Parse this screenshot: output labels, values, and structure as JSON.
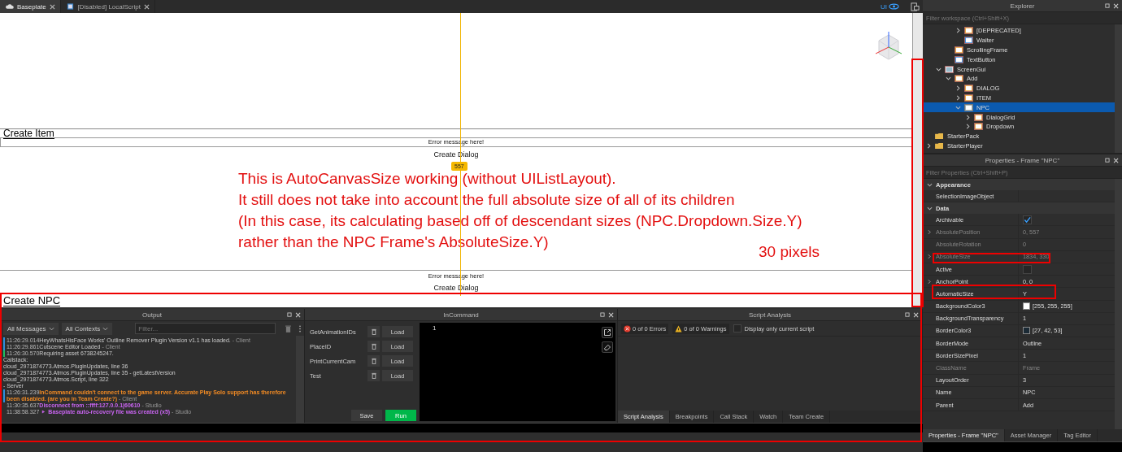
{
  "tabs": [
    {
      "label": "Baseplate",
      "selected": true
    },
    {
      "label": "[Disabled] LocalScript",
      "selected": false
    }
  ],
  "toolbar_right": {
    "label": "UI"
  },
  "viewport": {
    "item_label": "Create Item",
    "error_text_1": "Error message here!",
    "dialog_label_1": "Create Dialog",
    "badge": "557",
    "annotation_lines": [
      "This is AutoCanvasSize working (without UIListLayout).",
      "It still does not take into account the full absolute size of all of its children",
      "(In this case, its calculating based off of descendant sizes (NPC.Dropdown.Size.Y)",
      "rather than the NPC Frame's AbsoluteSize.Y)"
    ],
    "annotation_note": "30 pixels",
    "error_text_2": "Error message here!",
    "dialog_label_2": "Create Dialog",
    "npc_label": "Create NPC"
  },
  "output": {
    "title": "Output",
    "message_filter": "All Messages",
    "context_filter": "All Contexts",
    "filter_placeholder": "Filter...",
    "lines": [
      {
        "kind": "info",
        "color": "#2f8fdc",
        "time": "11:26:29.014",
        "message": "HeyWhatsHisFace Works' Outline Remover Plugin Version v1.1 has loaded.",
        "source": " - Client"
      },
      {
        "kind": "info",
        "color": "#2f8fdc",
        "time": "11:26:29.861",
        "message": "Cutscene Editor Loaded",
        "source": " - Client"
      },
      {
        "kind": "info",
        "color": "#1fbf5f",
        "time": "11:26:30.570",
        "message": "Requiring asset 6738245247."
      },
      {
        "kind": "plain",
        "message": "Callstack:"
      },
      {
        "kind": "plain",
        "message": "cloud_2971874773.Atmos.PluginUpdates, line 36"
      },
      {
        "kind": "plain",
        "message": "cloud_2971874773.Atmos.PluginUpdates, line 35 - getLatestVersion"
      },
      {
        "kind": "plain",
        "message": "cloud_2971874773.Atmos.Script, line 322"
      },
      {
        "kind": "plain",
        "message": "  - Server"
      },
      {
        "kind": "warning",
        "color": "#2f8fdc",
        "time": "11:26:31.239",
        "message": "InCommand couldn't connect to the game server. Accurate Play Solo support has therefore been disabled. (are you in Team Create?)",
        "source": " - Client"
      },
      {
        "kind": "studio",
        "time": "11:30:35.637",
        "message": "Disconnect from ::ffff:127.0.0.1|60610",
        "source": " - Studio"
      },
      {
        "kind": "studio_group",
        "time": "11:38:58.327",
        "message": "Baseplate auto-recovery file was created (x5)",
        "source": " - Studio"
      }
    ]
  },
  "incommand": {
    "title": "InCommand",
    "scripts": [
      {
        "name": "GetAnimationIDs",
        "action": "Load"
      },
      {
        "name": "PlaceID",
        "action": "Load"
      },
      {
        "name": "PrintCurrentCam",
        "action": "Load"
      },
      {
        "name": "Test",
        "action": "Load"
      }
    ],
    "line_number": "1",
    "save": "Save",
    "run": "Run"
  },
  "script_analysis": {
    "title": "Script Analysis",
    "errors": "0 of 0 Errors",
    "warnings": "0 of 0 Warnings",
    "only_current": {
      "label": "Display only current script",
      "checked": false
    },
    "tabs": [
      {
        "label": "Script Analysis",
        "selected": true
      },
      {
        "label": "Breakpoints",
        "selected": false
      },
      {
        "label": "Call Stack",
        "selected": false
      },
      {
        "label": "Watch",
        "selected": false
      },
      {
        "label": "Team Create",
        "selected": false
      }
    ]
  },
  "explorer": {
    "title": "Explorer",
    "filter_placeholder": "Filter workspace (Ctrl+Shift+X)",
    "tree": [
      {
        "children": [
          {
            "children": [
              {
                "children": [
                  {
                    "label": "[DEPRECATED]",
                    "kind": "frame",
                    "expanded": false,
                    "selected": false
                  },
                  {
                    "label": "Waiter",
                    "kind": "label",
                    "selected": false
                  }
                ]
              },
              {
                "label": "ScrollingFrame",
                "kind": "frame",
                "selected": false
              },
              {
                "label": "TextButton",
                "kind": "button",
                "selected": false
              }
            ]
          },
          {
            "label": "ScreenGui",
            "kind": "gui",
            "expanded": true,
            "selected": false,
            "children": [
              {
                "label": "Add",
                "kind": "frame",
                "expanded": true,
                "selected": false,
                "children": [
                  {
                    "label": "DIALOG",
                    "kind": "frame",
                    "expanded": false,
                    "selected": false
                  },
                  {
                    "label": "ITEM",
                    "kind": "frame",
                    "expanded": false,
                    "selected": false
                  },
                  {
                    "label": "NPC",
                    "kind": "frame",
                    "expanded": true,
                    "selected": true,
                    "children": [
                      {
                        "label": "DialogGrid",
                        "kind": "frame",
                        "expanded": false,
                        "selected": false
                      },
                      {
                        "label": "Dropdown",
                        "kind": "frame",
                        "expanded": false,
                        "selected": false
                      }
                    ]
                  }
                ]
              }
            ]
          }
        ]
      },
      {
        "label": "StarterPack",
        "kind": "folder",
        "selected": false
      },
      {
        "label": "StarterPlayer",
        "kind": "folder",
        "expanded": false,
        "selected": false
      }
    ]
  },
  "properties": {
    "title": "Properties - Frame \"NPC\"",
    "filter_placeholder": "Filter Properties (Ctrl+Shift+P)",
    "sections": [
      {
        "label": "Appearance",
        "expanded": true,
        "rows": [
          {
            "name": "SelectionImageObject",
            "kind": "text",
            "disabled": false
          }
        ]
      },
      {
        "label": "Data",
        "expanded": true,
        "rows": [
          {
            "name": "Archivable",
            "kind": "checkbox",
            "checked": true,
            "disabled": false
          },
          {
            "name": "AbsolutePosition",
            "value": "0, 557",
            "kind": "text",
            "disabled": true,
            "expandable": true
          },
          {
            "name": "AbsoluteRotation",
            "value": "0",
            "kind": "text",
            "disabled": true
          },
          {
            "name": "AbsoluteSize",
            "value": "1834, 330",
            "kind": "text",
            "disabled": true,
            "expandable": true
          },
          {
            "name": "Active",
            "kind": "checkbox",
            "checked": false,
            "disabled": false
          },
          {
            "name": "AnchorPoint",
            "value": "0, 0",
            "kind": "text",
            "disabled": false,
            "expandable": true
          },
          {
            "name": "AutomaticSize",
            "value": "Y",
            "kind": "text",
            "disabled": false
          },
          {
            "name": "BackgroundColor3",
            "value": "[255, 255, 255]",
            "kind": "color",
            "color": "#ffffff",
            "disabled": false
          },
          {
            "name": "BackgroundTransparency",
            "value": "1",
            "kind": "text",
            "disabled": false
          },
          {
            "name": "BorderColor3",
            "value": "[27, 42, 53]",
            "kind": "color",
            "color": "#1b2a35",
            "disabled": false
          },
          {
            "name": "BorderMode",
            "value": "Outline",
            "kind": "text",
            "disabled": false
          },
          {
            "name": "BorderSizePixel",
            "value": "1",
            "kind": "text",
            "disabled": false
          },
          {
            "name": "ClassName",
            "value": "Frame",
            "kind": "text",
            "disabled": true
          },
          {
            "name": "LayoutOrder",
            "value": "3",
            "kind": "text",
            "disabled": false
          },
          {
            "name": "Name",
            "value": "NPC",
            "kind": "text",
            "disabled": false
          },
          {
            "name": "Parent",
            "value": "Add",
            "kind": "text",
            "disabled": false
          }
        ]
      }
    ],
    "tabs": [
      {
        "label": "Properties - Frame \"NPC\"",
        "selected": true
      },
      {
        "label": "Asset Manager",
        "selected": false
      },
      {
        "label": "Tag Editor",
        "selected": false
      }
    ]
  }
}
